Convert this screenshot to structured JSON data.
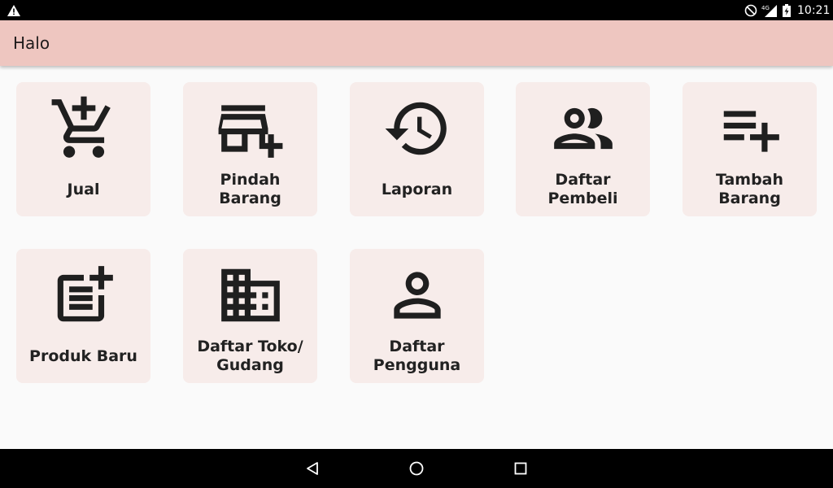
{
  "status_bar": {
    "time": "10:21",
    "network": "4G",
    "icons": [
      "warning-icon",
      "do-not-disturb-icon",
      "signal-icon",
      "battery-charging-icon"
    ]
  },
  "app_bar": {
    "title": "Halo"
  },
  "menu": {
    "items": [
      {
        "label": "Jual",
        "icon": "add-shopping-cart-icon"
      },
      {
        "label": "Pindah Barang",
        "icon": "add-business-icon"
      },
      {
        "label": "Laporan",
        "icon": "history-icon"
      },
      {
        "label": "Daftar Pembeli",
        "icon": "people-icon"
      },
      {
        "label": "Tambah Barang",
        "icon": "playlist-add-icon"
      },
      {
        "label": "Produk Baru",
        "icon": "post-add-icon"
      },
      {
        "label": "Daftar Toko/\nGudang",
        "icon": "domain-icon"
      },
      {
        "label": "Daftar\nPengguna",
        "icon": "person-icon"
      }
    ]
  },
  "colors": {
    "app_bar": "#eec6c0",
    "tile": "#f7ecea",
    "icon": "#1f1f1f",
    "background": "#fafafa"
  },
  "nav_bar": {
    "buttons": [
      "back-icon",
      "home-icon",
      "recent-apps-icon"
    ]
  }
}
